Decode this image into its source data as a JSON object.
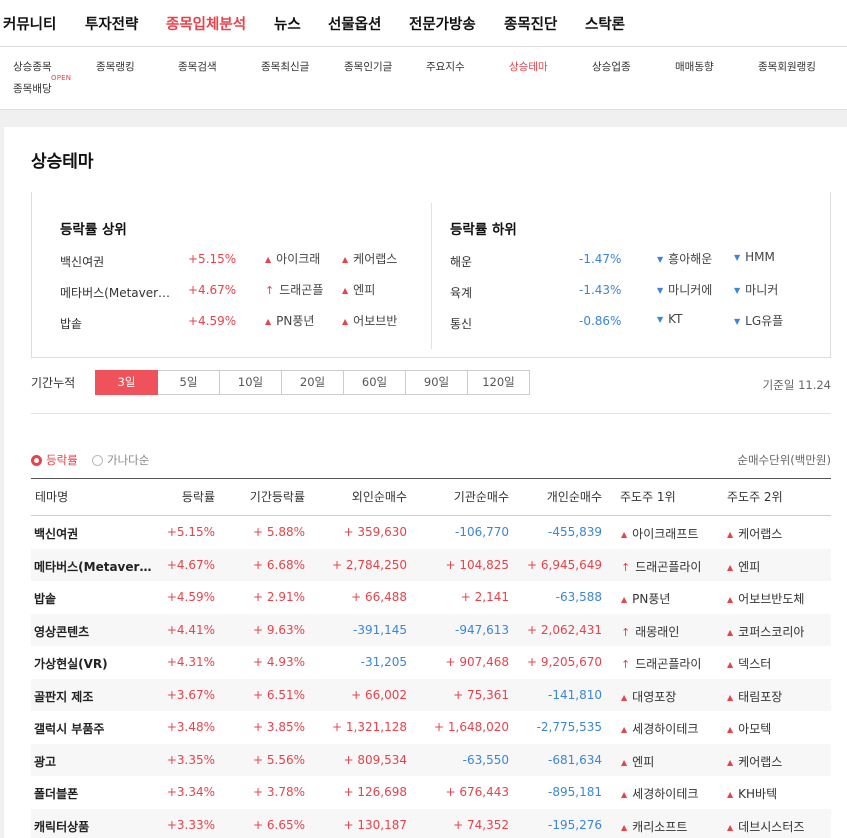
{
  "top_nav": [
    {
      "label": "커뮤니티",
      "active": false
    },
    {
      "label": "투자전략",
      "active": false
    },
    {
      "label": "종목입체분석",
      "active": true
    },
    {
      "label": "뉴스",
      "active": false
    },
    {
      "label": "선물옵션",
      "active": false
    },
    {
      "label": "전문가방송",
      "active": false
    },
    {
      "label": "종목진단",
      "active": false
    },
    {
      "label": "스탁론",
      "active": false
    }
  ],
  "sub_nav": [
    {
      "label": "상승종목",
      "active": false
    },
    {
      "label": "종목랭킹",
      "active": false
    },
    {
      "label": "종목검색",
      "active": false
    },
    {
      "label": "종목최신글",
      "active": false
    },
    {
      "label": "종목인기글",
      "active": false
    },
    {
      "label": "주요지수",
      "active": false
    },
    {
      "label": "상승테마",
      "active": true
    },
    {
      "label": "상승업종",
      "active": false
    },
    {
      "label": "매매동향",
      "active": false
    },
    {
      "label": "종목회원랭킹",
      "active": false
    },
    {
      "label": "종목배당",
      "active": false
    }
  ],
  "sub_nav_badge": "OPEN",
  "page_title": "상승테마",
  "summary": {
    "top_heading": "등락률 상위",
    "bottom_heading": "등락률 하위",
    "top": [
      {
        "name": "백신여권",
        "rate": "+5.15%",
        "s1": "아이크래",
        "s1_icon": "tri",
        "s2": "케어랩스",
        "s2_icon": "tri"
      },
      {
        "name": "메타버스(Metaver…",
        "rate": "+4.67%",
        "s1": "드래곤플",
        "s1_icon": "arrow",
        "s2": "엔피",
        "s2_icon": "tri"
      },
      {
        "name": "밥솥",
        "rate": "+4.59%",
        "s1": "PN풍년",
        "s1_icon": "tri",
        "s2": "어보브반",
        "s2_icon": "tri"
      }
    ],
    "bottom": [
      {
        "name": "해운",
        "rate": "-1.47%",
        "s1": "흥아해운",
        "s2": "HMM"
      },
      {
        "name": "육계",
        "rate": "-1.43%",
        "s1": "마니커에",
        "s2": "마니커"
      },
      {
        "name": "통신",
        "rate": "-0.86%",
        "s1": "KT",
        "s2": "LG유플"
      }
    ]
  },
  "period": {
    "label": "기간누적",
    "options": [
      "3일",
      "5일",
      "10일",
      "20일",
      "60일",
      "90일",
      "120일"
    ],
    "selected": "3일",
    "base_date": "기준일 11.24"
  },
  "sort": {
    "options": [
      "등락률",
      "가나다순"
    ],
    "selected": "등락률",
    "unit": "순매수단위(백만원)"
  },
  "table": {
    "headers": [
      "테마명",
      "등락률",
      "기간등락률",
      "외인순매수",
      "기관순매수",
      "개인순매수",
      "주도주 1위",
      "주도주 2위"
    ],
    "rows": [
      {
        "name": "백신여권",
        "rate": "+5.15%",
        "period": "+ 5.88%",
        "foreign": "+ 359,630",
        "inst": "-106,770",
        "indiv": "-455,839",
        "lead1": "아이크래프트",
        "lead1_icon": "tri",
        "lead2": "케어랩스"
      },
      {
        "name": "메타버스(Metaver…",
        "rate": "+4.67%",
        "period": "+ 6.68%",
        "foreign": "+ 2,784,250",
        "inst": "+ 104,825",
        "indiv": "+ 6,945,649",
        "lead1": "드래곤플라이",
        "lead1_icon": "arrow",
        "lead2": "엔피"
      },
      {
        "name": "밥솥",
        "rate": "+4.59%",
        "period": "+ 2.91%",
        "foreign": "+ 66,488",
        "inst": "+ 2,141",
        "indiv": "-63,588",
        "lead1": "PN풍년",
        "lead1_icon": "tri",
        "lead2": "어보브반도체"
      },
      {
        "name": "영상콘텐츠",
        "rate": "+4.41%",
        "period": "+ 9.63%",
        "foreign": "-391,145",
        "inst": "-947,613",
        "indiv": "+ 2,062,431",
        "lead1": "래몽래인",
        "lead1_icon": "arrow",
        "lead2": "코퍼스코리아"
      },
      {
        "name": "가상현실(VR)",
        "rate": "+4.31%",
        "period": "+ 4.93%",
        "foreign": "-31,205",
        "inst": "+ 907,468",
        "indiv": "+ 9,205,670",
        "lead1": "드래곤플라이",
        "lead1_icon": "arrow",
        "lead2": "덱스터"
      },
      {
        "name": "골판지 제조",
        "rate": "+3.67%",
        "period": "+ 6.51%",
        "foreign": "+ 66,002",
        "inst": "+ 75,361",
        "indiv": "-141,810",
        "lead1": "대영포장",
        "lead1_icon": "tri",
        "lead2": "태림포장"
      },
      {
        "name": "갤럭시 부품주",
        "rate": "+3.48%",
        "period": "+ 3.85%",
        "foreign": "+ 1,321,128",
        "inst": "+ 1,648,020",
        "indiv": "-2,775,535",
        "lead1": "세경하이테크",
        "lead1_icon": "tri",
        "lead2": "아모텍"
      },
      {
        "name": "광고",
        "rate": "+3.35%",
        "period": "+ 5.56%",
        "foreign": "+ 809,534",
        "inst": "-63,550",
        "indiv": "-681,634",
        "lead1": "엔피",
        "lead1_icon": "tri",
        "lead2": "케어랩스"
      },
      {
        "name": "폴더블폰",
        "rate": "+3.34%",
        "period": "+ 3.78%",
        "foreign": "+ 126,698",
        "inst": "+ 676,443",
        "indiv": "-895,181",
        "lead1": "세경하이테크",
        "lead1_icon": "tri",
        "lead2": "KH바텍"
      },
      {
        "name": "캐릭터상품",
        "rate": "+3.33%",
        "period": "+ 6.65%",
        "foreign": "+ 130,187",
        "inst": "+ 74,352",
        "indiv": "-195,276",
        "lead1": "캐리소프트",
        "lead1_icon": "tri",
        "lead2": "데브시스터즈"
      }
    ]
  },
  "colors": {
    "up": "#e8434b",
    "down": "#3b86d8",
    "accent": "#f0525b"
  }
}
